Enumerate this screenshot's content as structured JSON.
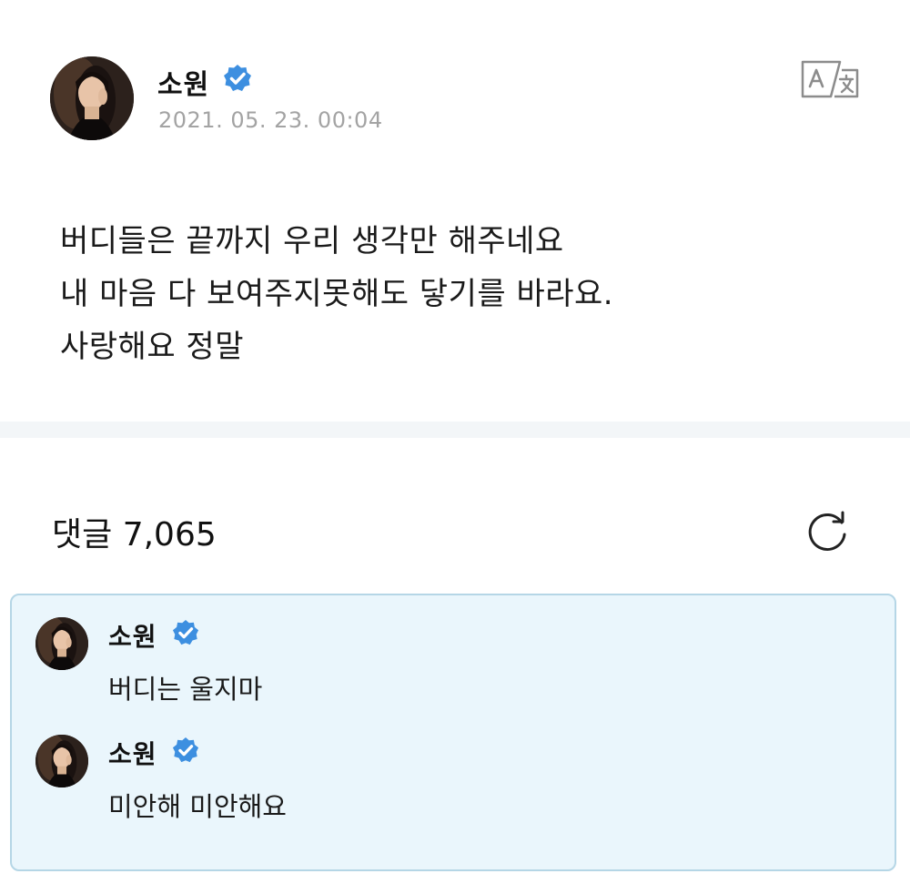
{
  "post": {
    "author": "소원",
    "verified_icon": "verified-check-icon",
    "date": "2021. 05. 23. 00:04",
    "translate_icon": "translate-icon",
    "body_lines": [
      "버디들은 끝까지 우리 생각만 해주네요",
      "내 마음 다 보여주지못해도 닿기를 바라요.",
      "사랑해요 정말"
    ]
  },
  "comments": {
    "label": "댓글",
    "count": "7,065",
    "refresh_icon": "refresh-icon",
    "items": [
      {
        "author": "소원",
        "text": "버디는 울지마"
      },
      {
        "author": "소원",
        "text": "미안해 미안해요"
      }
    ]
  },
  "colors": {
    "verified_blue": "#3d8fe0",
    "date_gray": "#a3a3a3",
    "comment_box_bg": "#eaf6fc",
    "comment_box_border": "#b5d6e6",
    "separator": "#f3f6f8"
  }
}
